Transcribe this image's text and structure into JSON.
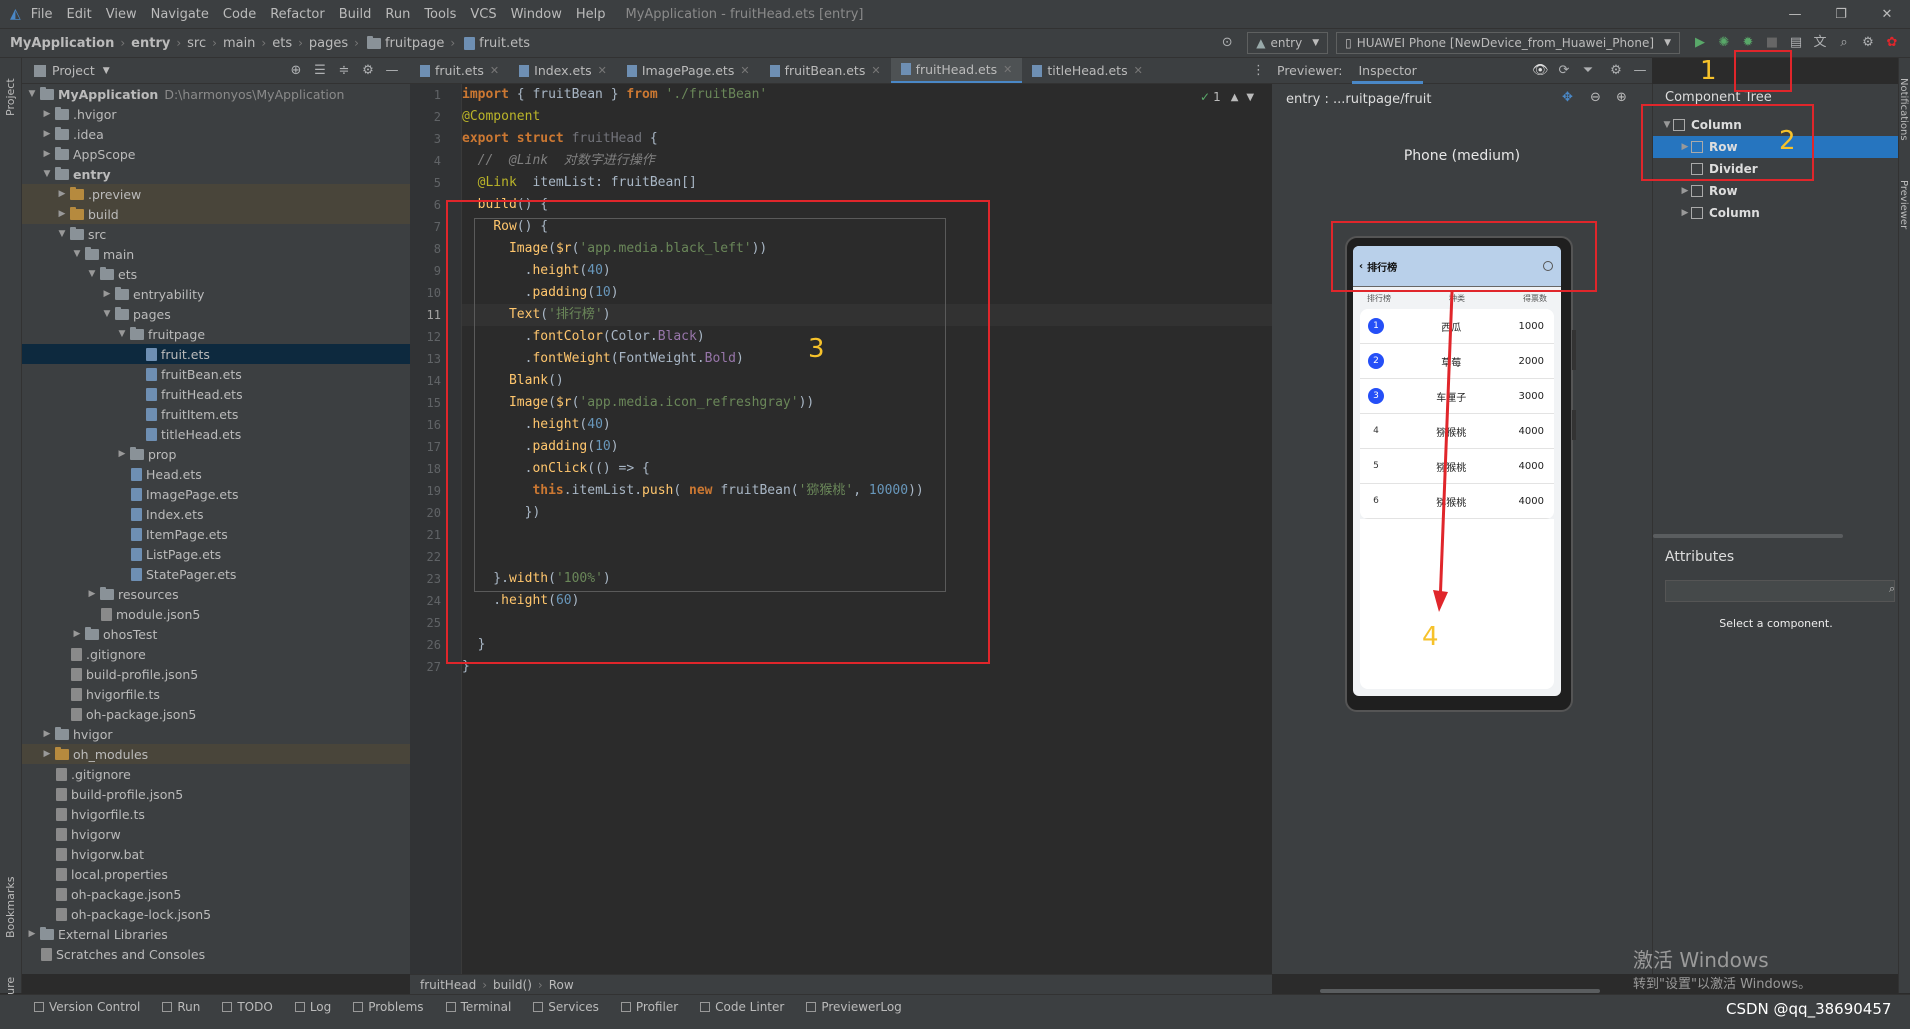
{
  "window": {
    "title": "MyApplication - fruitHead.ets [entry]",
    "menu": [
      "File",
      "Edit",
      "View",
      "Navigate",
      "Code",
      "Refactor",
      "Build",
      "Run",
      "Tools",
      "VCS",
      "Window",
      "Help"
    ]
  },
  "breadcrumb": [
    "MyApplication",
    "entry",
    "src",
    "main",
    "ets",
    "pages",
    "fruitpage",
    "fruit.ets"
  ],
  "run_config": "entry",
  "device": "HUAWEI Phone [NewDevice_from_Huawei_Phone]",
  "project_panel": {
    "title": "Project",
    "root_name": "MyApplication",
    "root_path": "D:\\harmonyos\\MyApplication",
    "tree": [
      {
        "label": "MyApplication",
        "depth": 0,
        "type": "root"
      },
      {
        "label": ".hvigor",
        "depth": 1,
        "type": "folder"
      },
      {
        "label": ".idea",
        "depth": 1,
        "type": "folder"
      },
      {
        "label": "AppScope",
        "depth": 1,
        "type": "folder"
      },
      {
        "label": "entry",
        "depth": 1,
        "type": "folder",
        "open": true,
        "bold": true
      },
      {
        "label": ".preview",
        "depth": 2,
        "type": "folder-orange",
        "hl": true
      },
      {
        "label": "build",
        "depth": 2,
        "type": "folder-orange",
        "hl": true
      },
      {
        "label": "src",
        "depth": 2,
        "type": "folder",
        "open": true
      },
      {
        "label": "main",
        "depth": 3,
        "type": "folder",
        "open": true
      },
      {
        "label": "ets",
        "depth": 4,
        "type": "folder",
        "open": true
      },
      {
        "label": "entryability",
        "depth": 5,
        "type": "folder"
      },
      {
        "label": "pages",
        "depth": 5,
        "type": "folder",
        "open": true
      },
      {
        "label": "fruitpage",
        "depth": 6,
        "type": "folder",
        "open": true
      },
      {
        "label": "fruit.ets",
        "depth": 7,
        "type": "file",
        "sel": true
      },
      {
        "label": "fruitBean.ets",
        "depth": 7,
        "type": "file"
      },
      {
        "label": "fruitHead.ets",
        "depth": 7,
        "type": "file"
      },
      {
        "label": "fruitItem.ets",
        "depth": 7,
        "type": "file"
      },
      {
        "label": "titleHead.ets",
        "depth": 7,
        "type": "file"
      },
      {
        "label": "prop",
        "depth": 6,
        "type": "folder"
      },
      {
        "label": "Head.ets",
        "depth": 6,
        "type": "file"
      },
      {
        "label": "ImagePage.ets",
        "depth": 6,
        "type": "file"
      },
      {
        "label": "Index.ets",
        "depth": 6,
        "type": "file"
      },
      {
        "label": "ItemPage.ets",
        "depth": 6,
        "type": "file"
      },
      {
        "label": "ListPage.ets",
        "depth": 6,
        "type": "file"
      },
      {
        "label": "StatePager.ets",
        "depth": 6,
        "type": "file"
      },
      {
        "label": "resources",
        "depth": 4,
        "type": "folder"
      },
      {
        "label": "module.json5",
        "depth": 4,
        "type": "json"
      },
      {
        "label": "ohosTest",
        "depth": 3,
        "type": "folder"
      },
      {
        "label": ".gitignore",
        "depth": 2,
        "type": "json"
      },
      {
        "label": "build-profile.json5",
        "depth": 2,
        "type": "json"
      },
      {
        "label": "hvigorfile.ts",
        "depth": 2,
        "type": "json"
      },
      {
        "label": "oh-package.json5",
        "depth": 2,
        "type": "json"
      },
      {
        "label": "hvigor",
        "depth": 1,
        "type": "folder"
      },
      {
        "label": "oh_modules",
        "depth": 1,
        "type": "folder-orange",
        "hl": true
      },
      {
        "label": ".gitignore",
        "depth": 1,
        "type": "json"
      },
      {
        "label": "build-profile.json5",
        "depth": 1,
        "type": "json"
      },
      {
        "label": "hvigorfile.ts",
        "depth": 1,
        "type": "json"
      },
      {
        "label": "hvigorw",
        "depth": 1,
        "type": "json"
      },
      {
        "label": "hvigorw.bat",
        "depth": 1,
        "type": "json"
      },
      {
        "label": "local.properties",
        "depth": 1,
        "type": "json"
      },
      {
        "label": "oh-package.json5",
        "depth": 1,
        "type": "json"
      },
      {
        "label": "oh-package-lock.json5",
        "depth": 1,
        "type": "json"
      },
      {
        "label": "External Libraries",
        "depth": 0,
        "type": "folder"
      },
      {
        "label": "Scratches and Consoles",
        "depth": 0,
        "type": "scratch"
      }
    ]
  },
  "editor_tabs": [
    {
      "label": "fruit.ets"
    },
    {
      "label": "Index.ets"
    },
    {
      "label": "ImagePage.ets"
    },
    {
      "label": "fruitBean.ets"
    },
    {
      "label": "fruitHead.ets",
      "active": true
    },
    {
      "label": "titleHead.ets"
    }
  ],
  "inspection_count": "1",
  "code_lines": [
    "<span class=\"kw\">import</span> { fruitBean } <span class=\"kw\">from</span> <span class=\"str\">'./fruitBean'</span>",
    "<span class=\"ann\">@Component</span>",
    "<span class=\"kw\">export struct</span> <span class=\"ghost\">fruitHead</span> {",
    "  <span class=\"cmt\">//  @Link  对数字进行操作</span>",
    "  <span class=\"ann\">@Link</span>  itemList: <span class=\"ty\">fruitBean</span>[]",
    "  <span class=\"fn\">build</span>() {",
    "    <span class=\"fn\">Row</span>() {",
    "      <span class=\"fn\">Image</span>(<span class=\"fn\">$r</span>(<span class=\"str\">'app.media.black_left'</span>))",
    "        .<span class=\"fn\">height</span>(<span class=\"num\">40</span>)",
    "        .<span class=\"fn\">padding</span>(<span class=\"num\">10</span>)",
    "      <span class=\"fn\">Text</span>(<span class=\"str\">'排行榜'</span>)",
    "        .<span class=\"fn\">fontColor</span>(Color.<span class=\"prop\">Black</span>)",
    "        .<span class=\"fn\">fontWeight</span>(FontWeight.<span class=\"prop\">Bold</span>)",
    "      <span class=\"fn\">Blank</span>()",
    "      <span class=\"fn\">Image</span>(<span class=\"fn\">$r</span>(<span class=\"str\">'app.media.icon_refreshgray'</span>))",
    "        .<span class=\"fn\">height</span>(<span class=\"num\">40</span>)",
    "        .<span class=\"fn\">padding</span>(<span class=\"num\">10</span>)",
    "        .<span class=\"fn\">onClick</span>(() => {",
    "         <span class=\"kw\">this</span>.itemList.<span class=\"fn\">push</span>( <span class=\"kw\">new</span> <span class=\"ty\">fruitBean</span>(<span class=\"str\">'猕猴桃'</span>, <span class=\"num\">10000</span>))",
    "        })",
    "",
    "",
    "    }.<span class=\"fn\">width</span>(<span class=\"str\">'100%'</span>)",
    "    .<span class=\"fn\">height</span>(<span class=\"num\">60</span>)",
    "",
    "  }",
    "}"
  ],
  "previewer": {
    "tab_previewer": "Previewer:",
    "tab_inspector": "Inspector",
    "path": "entry : ...ruitpage/fruit",
    "device_label": "Phone (medium)",
    "app_title": "排行榜",
    "columns": [
      "排行榜",
      "种类",
      "得票数"
    ],
    "rows": [
      {
        "rank": "1",
        "name": "西瓜",
        "votes": "1000",
        "badge": true
      },
      {
        "rank": "2",
        "name": "草莓",
        "votes": "2000",
        "badge": true
      },
      {
        "rank": "3",
        "name": "车厘子",
        "votes": "3000",
        "badge": true
      },
      {
        "rank": "4",
        "name": "猕猴桃",
        "votes": "4000",
        "badge": false
      },
      {
        "rank": "5",
        "name": "猕猴桃",
        "votes": "4000",
        "badge": false
      },
      {
        "rank": "6",
        "name": "猕猴桃",
        "votes": "4000",
        "badge": false
      }
    ]
  },
  "component_tree": {
    "title": "Component Tree",
    "nodes": [
      {
        "label": "Column",
        "depth": 0,
        "open": true
      },
      {
        "label": "Row",
        "depth": 1,
        "sel": true
      },
      {
        "label": "Divider",
        "depth": 1
      },
      {
        "label": "Row",
        "depth": 1
      },
      {
        "label": "Column",
        "depth": 1
      }
    ]
  },
  "attributes": {
    "title": "Attributes",
    "empty": "Select a component."
  },
  "annotations": [
    "1",
    "2",
    "3",
    "4"
  ],
  "bottom_breadcrumb": [
    "fruitHead",
    "build()",
    "Row"
  ],
  "tool_windows": [
    "Version Control",
    "Run",
    "TODO",
    "Log",
    "Problems",
    "Terminal",
    "Services",
    "Profiler",
    "Code Linter",
    "PreviewerLog"
  ],
  "left_strip": [
    "Project",
    "Bookmarks",
    "Structure"
  ],
  "right_strip": [
    "Notifications",
    "Previewer"
  ],
  "watermark": {
    "line1": "激活 Windows",
    "line2": "转到\"设置\"以激活 Windows。"
  },
  "csdn": "CSDN @qq_38690457"
}
